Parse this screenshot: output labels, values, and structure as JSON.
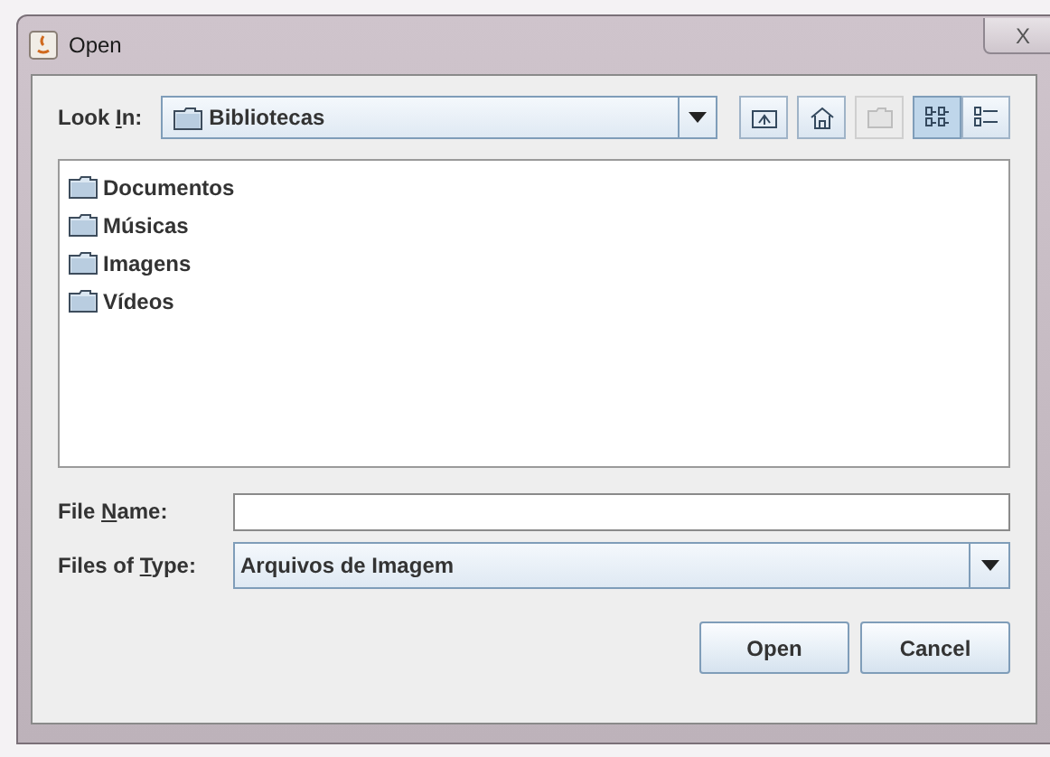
{
  "window": {
    "title": "Open",
    "close": "X"
  },
  "look_in": {
    "label": {
      "before": "Look ",
      "mnemonic": "I",
      "after": "n:"
    },
    "value": "Bibliotecas"
  },
  "toolbar": [
    {
      "kind": "up",
      "selected": false,
      "disabled": false
    },
    {
      "kind": "home",
      "selected": false,
      "disabled": false
    },
    {
      "kind": "new_folder",
      "selected": false,
      "disabled": true
    },
    {
      "kind": "list",
      "selected": true,
      "disabled": false
    },
    {
      "kind": "details",
      "selected": false,
      "disabled": false
    }
  ],
  "files": [
    {
      "name": "Documentos"
    },
    {
      "name": "Músicas"
    },
    {
      "name": "Imagens"
    },
    {
      "name": "Vídeos"
    }
  ],
  "file_name": {
    "label": {
      "before": "File ",
      "mnemonic": "N",
      "after": "ame:"
    }
  },
  "files_of_type": {
    "label": {
      "before": "Files of ",
      "mnemonic": "T",
      "after": "ype:"
    },
    "value": "Arquivos de Imagem"
  },
  "buttons": [
    {
      "label": "Open"
    },
    {
      "label": "Cancel"
    }
  ]
}
